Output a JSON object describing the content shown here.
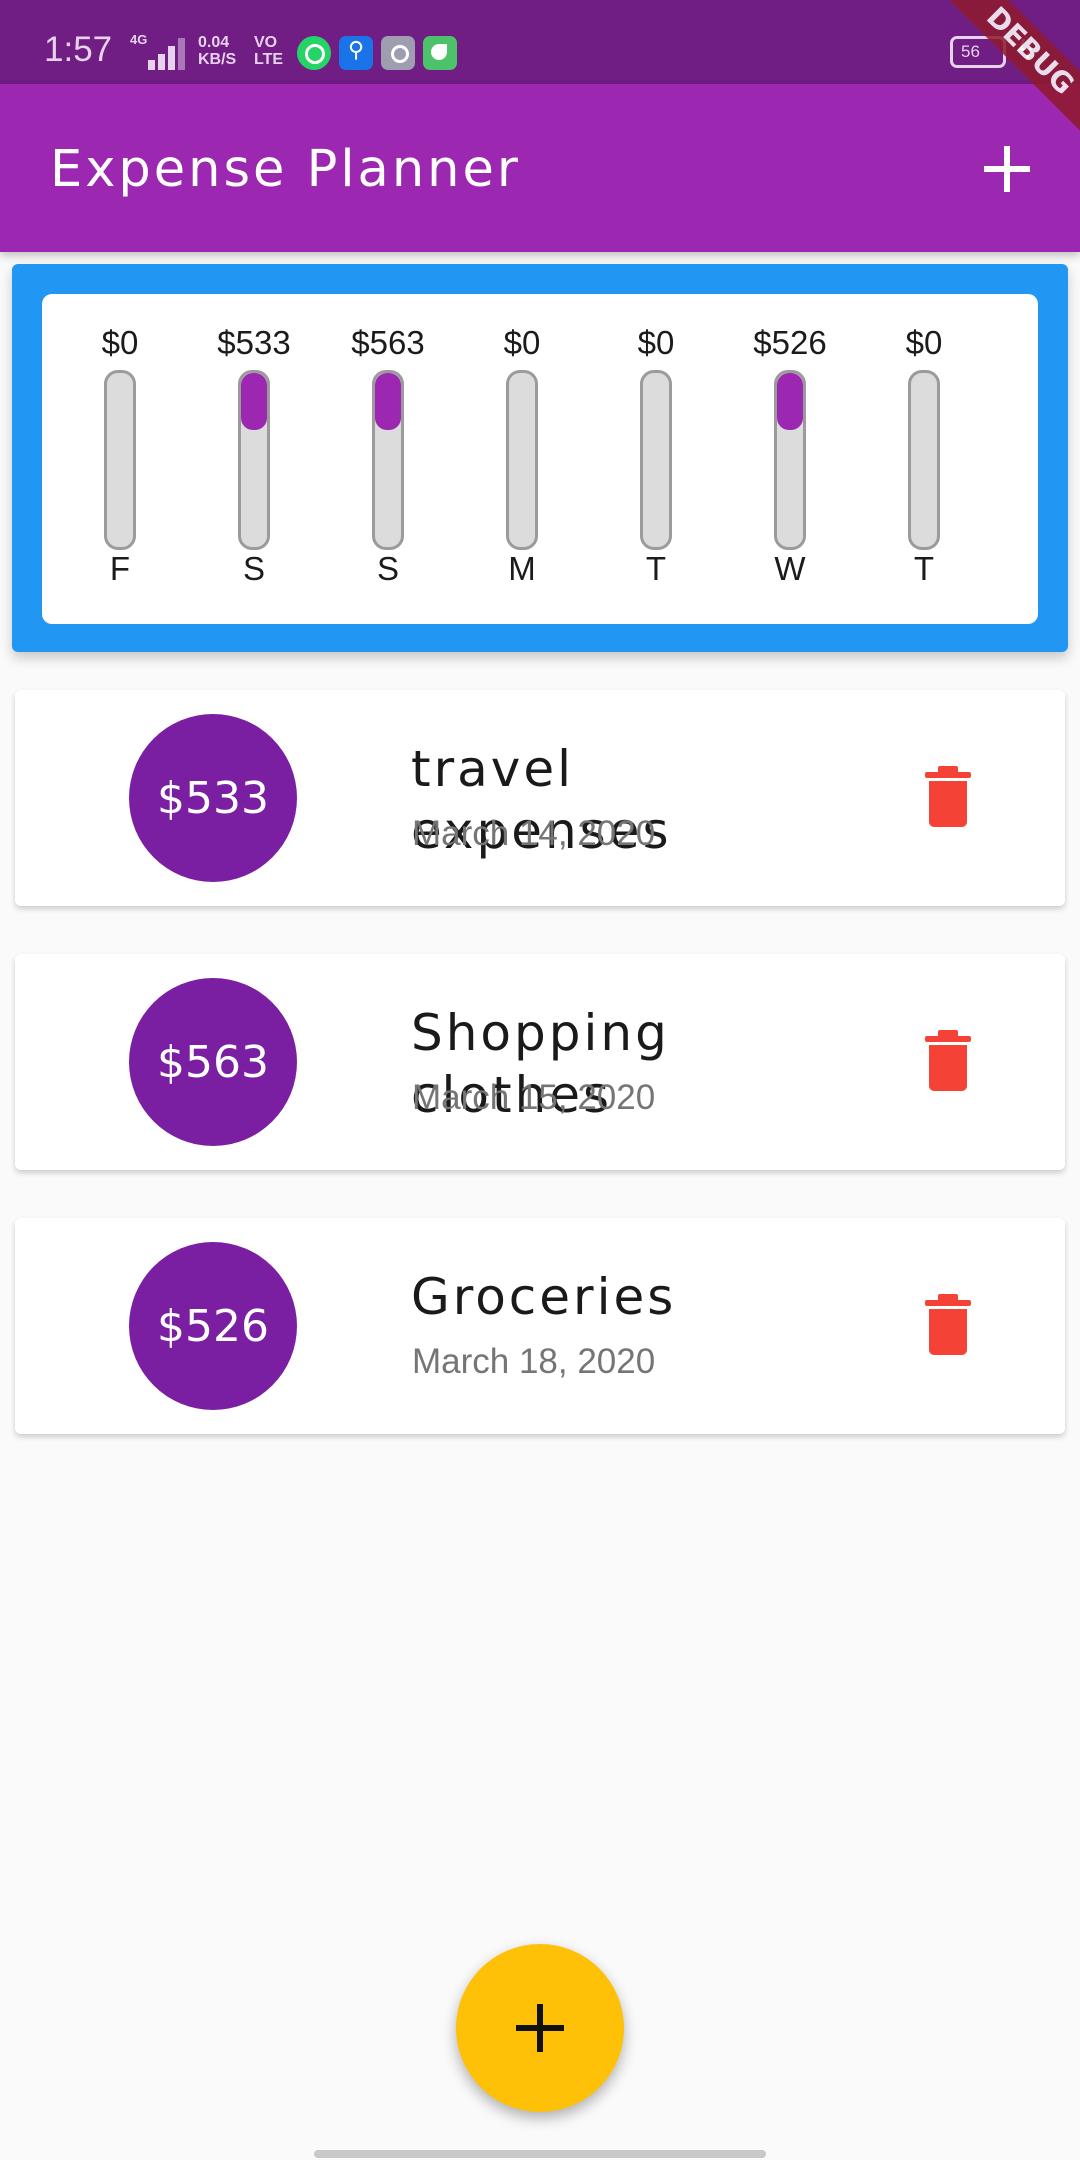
{
  "status_bar": {
    "time": "1:57",
    "network_type": "4G",
    "data_speed": "0.04",
    "data_speed_unit": "KB/S",
    "volte_top": "VO",
    "volte_bottom": "LTE",
    "battery": "56",
    "icons": [
      "whatsapp-icon",
      "usb-icon",
      "share-icon",
      "leaf-icon"
    ]
  },
  "app_bar": {
    "title": "Expense Planner",
    "add_icon": "plus-icon"
  },
  "debug_banner": "DEBUG",
  "chart_data": {
    "type": "bar",
    "categories": [
      "F",
      "S",
      "S",
      "M",
      "T",
      "W",
      "T"
    ],
    "values": [
      0,
      533,
      563,
      0,
      0,
      526,
      0
    ],
    "value_labels": [
      "$0",
      "$533",
      "$563",
      "$0",
      "$0",
      "$526",
      "$0"
    ],
    "fill_fraction": [
      0,
      0.33,
      0.33,
      0,
      0,
      0.33,
      0
    ],
    "colors": {
      "fill": "#9c27b0",
      "track": "#dcdcdc"
    }
  },
  "transactions": [
    {
      "amount": "$533",
      "title": "travel expenses",
      "date": "March 14, 2020"
    },
    {
      "amount": "$563",
      "title": "Shopping clothes",
      "date": "March 15, 2020"
    },
    {
      "amount": "$526",
      "title": "Groceries",
      "date": "March 18, 2020"
    }
  ],
  "colors": {
    "primary": "#9c27b0",
    "status_bar": "#701d84",
    "chart_background": "#2196f3",
    "avatar": "#7b1fa2",
    "delete": "#f44336",
    "fab": "#ffc107"
  }
}
